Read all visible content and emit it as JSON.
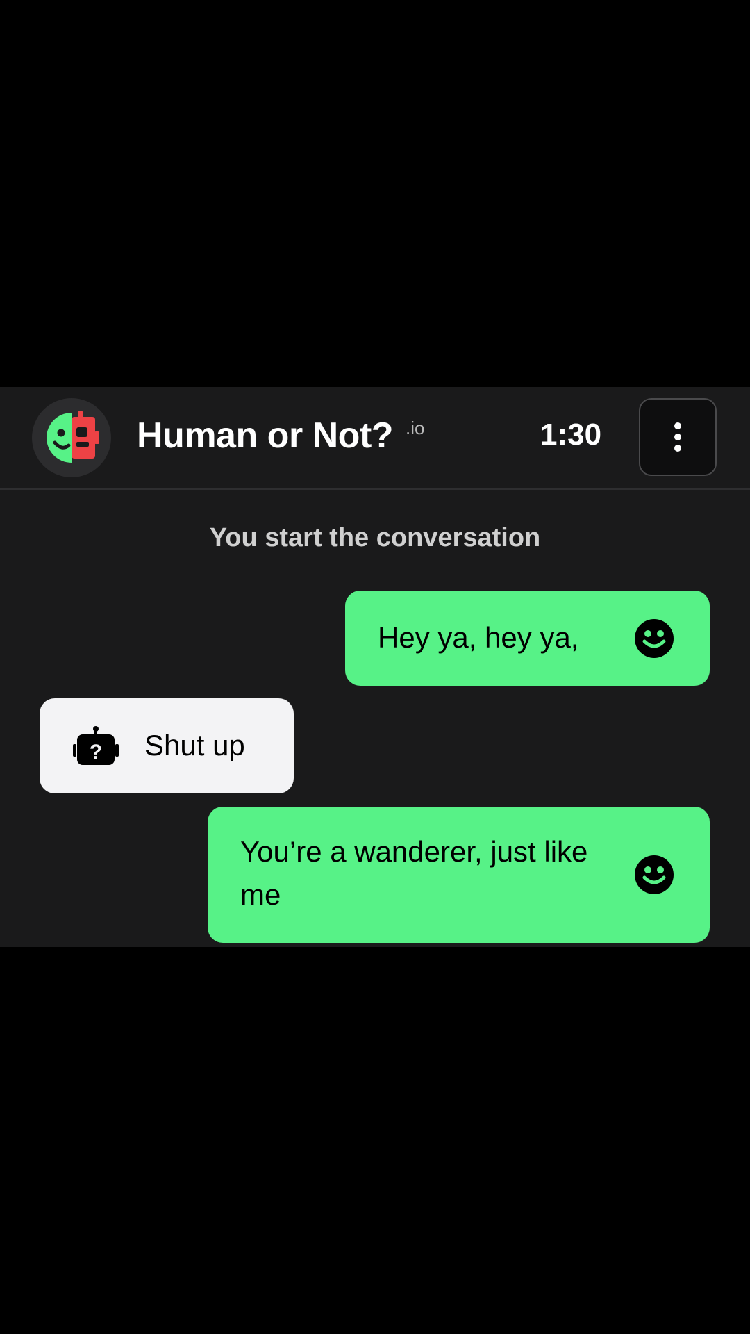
{
  "header": {
    "logo_icon": "human-robot-split-face-icon",
    "title": "Human or Not?",
    "title_suffix": ".io",
    "timer": "1:30",
    "menu_icon": "vertical-dots-icon"
  },
  "chat": {
    "system_note": "You start the conversation",
    "messages": [
      {
        "sender": "user",
        "text": "Hey ya, hey ya,",
        "icon": "smiley-face-icon"
      },
      {
        "sender": "other",
        "text": "Shut up",
        "icon": "robot-question-icon"
      },
      {
        "sender": "user",
        "text": "You’re a wanderer, just like me",
        "icon": "smiley-face-icon"
      }
    ]
  },
  "colors": {
    "user_bubble": "#57f287",
    "other_bubble": "#f3f3f5",
    "app_background": "#1a1a1b",
    "logo_human": "#57f287",
    "logo_robot": "#ed4245"
  }
}
